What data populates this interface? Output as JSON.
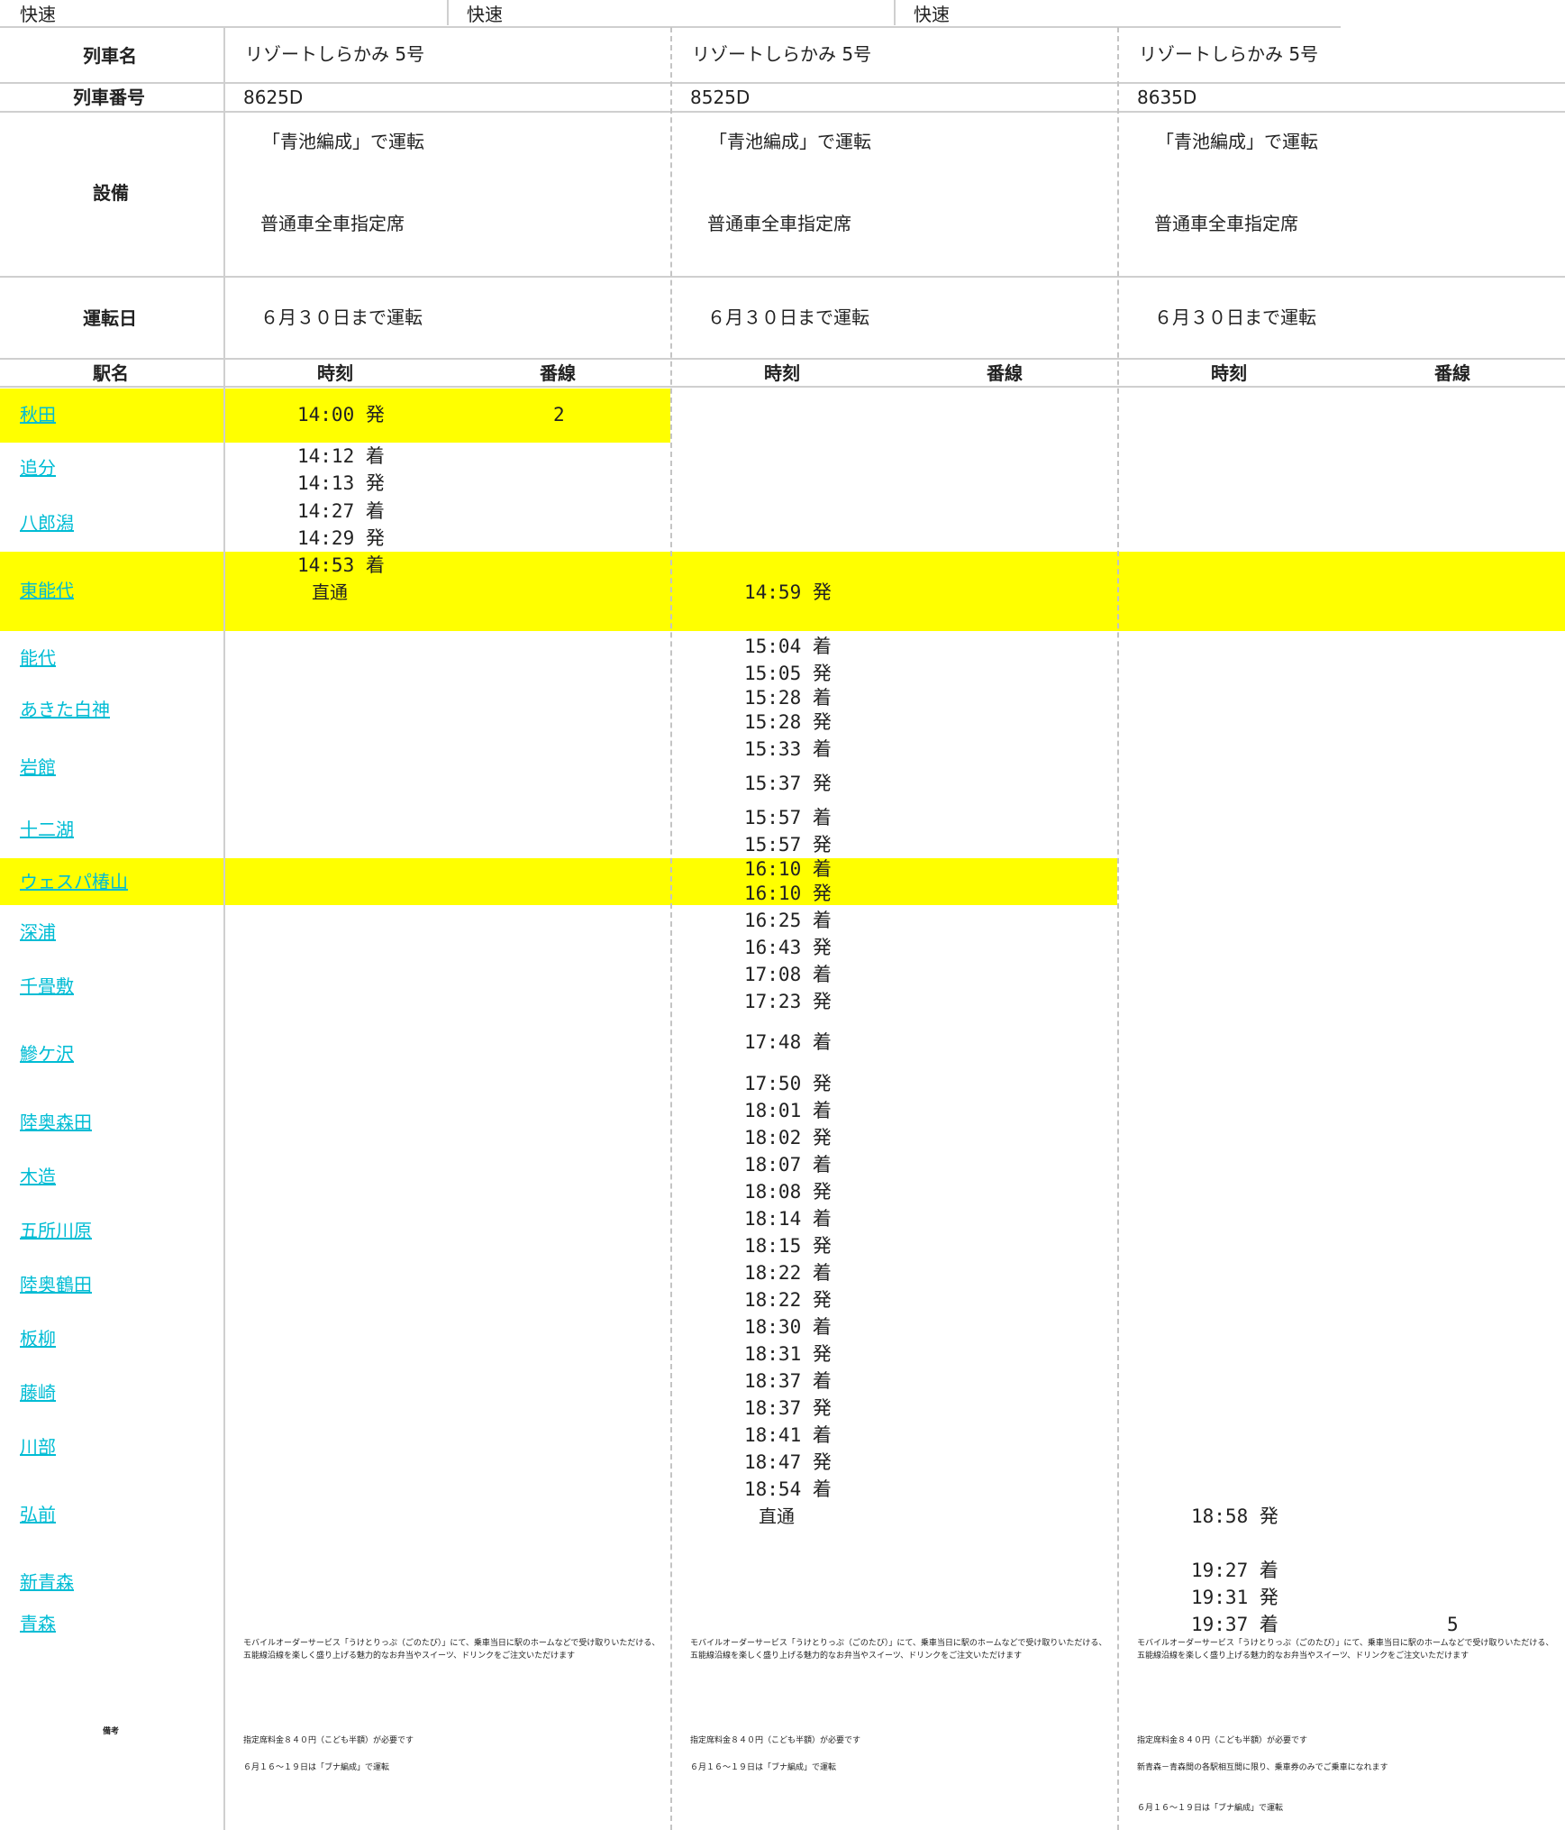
{
  "kind_row": [
    "快速",
    "快速",
    "快速"
  ],
  "labels": {
    "train_name": "列車名",
    "train_number": "列車番号",
    "equipment": "設備",
    "operation_day": "運転日",
    "station": "駅名",
    "time": "時刻",
    "track": "番線",
    "remarks": "備考"
  },
  "trains": [
    {
      "name": "リゾートしらかみ 5号",
      "number": "8625D",
      "equip1": "「青池編成」で運転",
      "equip2": "普通車全車指定席",
      "day": "６月３０日まで運転",
      "notes": [
        "モバイルオーダーサービス「うけとりっぷ（ごのたび）」にて、乗車当日に駅のホームなどで受け取りいただける、",
        "五能線沿線を楽しく盛り上げる魅力的なお弁当やスイーツ、ドリンクをご注文いただけます",
        "指定席料金８４０円（こども半額）が必要です",
        "６月１６～１９日は「ブナ編成」で運転"
      ]
    },
    {
      "name": "リゾートしらかみ 5号",
      "number": "8525D",
      "equip1": "「青池編成」で運転",
      "equip2": "普通車全車指定席",
      "day": "６月３０日まで運転",
      "notes": [
        "モバイルオーダーサービス「うけとりっぷ（ごのたび）」にて、乗車当日に駅のホームなどで受け取りいただける、",
        "五能線沿線を楽しく盛り上げる魅力的なお弁当やスイーツ、ドリンクをご注文いただけます",
        "指定席料金８４０円（こども半額）が必要です",
        "６月１６～１９日は「ブナ編成」で運転"
      ]
    },
    {
      "name": "リゾートしらかみ 5号",
      "number": "8635D",
      "equip1": "「青池編成」で運転",
      "equip2": "普通車全車指定席",
      "day": "６月３０日まで運転",
      "notes": [
        "モバイルオーダーサービス「うけとりっぷ（ごのたび）」にて、乗車当日に駅のホームなどで受け取りいただける、",
        "五能線沿線を楽しく盛り上げる魅力的なお弁当やスイーツ、ドリンクをご注文いただけます",
        "指定席料金８４０円（こども半額）が必要です",
        "新青森－青森間の各駅相互間に限り、乗車券のみでご乗車になれます",
        "６月１６～１９日は「ブナ編成」で運転"
      ]
    }
  ],
  "stations": [
    "秋田",
    "追分",
    "八郎潟",
    "東能代",
    "能代",
    "あきた白神",
    "岩館",
    "十二湖",
    "ウェスパ椿山",
    "深浦",
    "千畳敷",
    "鰺ケ沢",
    "陸奥森田",
    "木造",
    "五所川原",
    "陸奥鶴田",
    "板柳",
    "藤崎",
    "川部",
    "弘前",
    "新青森",
    "青森"
  ],
  "times": {
    "c1": [
      "14:00 発",
      "14:12 着",
      "14:13 発",
      "14:27 着",
      "14:29 発",
      "14:53 着",
      "直通"
    ],
    "c1_track": "2",
    "c2": [
      "14:59 発",
      "15:04 着",
      "15:05 発",
      "15:28 着",
      "15:28 発",
      "15:33 着",
      "15:37 発",
      "15:57 着",
      "15:57 発",
      "16:10 着",
      "16:10 発",
      "16:25 着",
      "16:43 発",
      "17:08 着",
      "17:23 発",
      "17:48 着",
      "17:50 発",
      "18:01 着",
      "18:02 発",
      "18:07 着",
      "18:08 発",
      "18:14 着",
      "18:15 発",
      "18:22 着",
      "18:22 発",
      "18:30 着",
      "18:31 発",
      "18:37 着",
      "18:37 発",
      "18:41 着",
      "18:47 発",
      "18:54 着",
      "直通"
    ],
    "c3": [
      "18:58 発",
      "19:27 着",
      "19:31 発",
      "19:37 着"
    ],
    "c3_track": "5"
  },
  "colors": {
    "highlight": "#ffff00",
    "link": "#00bcd4",
    "rule": "#cfcfcf"
  }
}
